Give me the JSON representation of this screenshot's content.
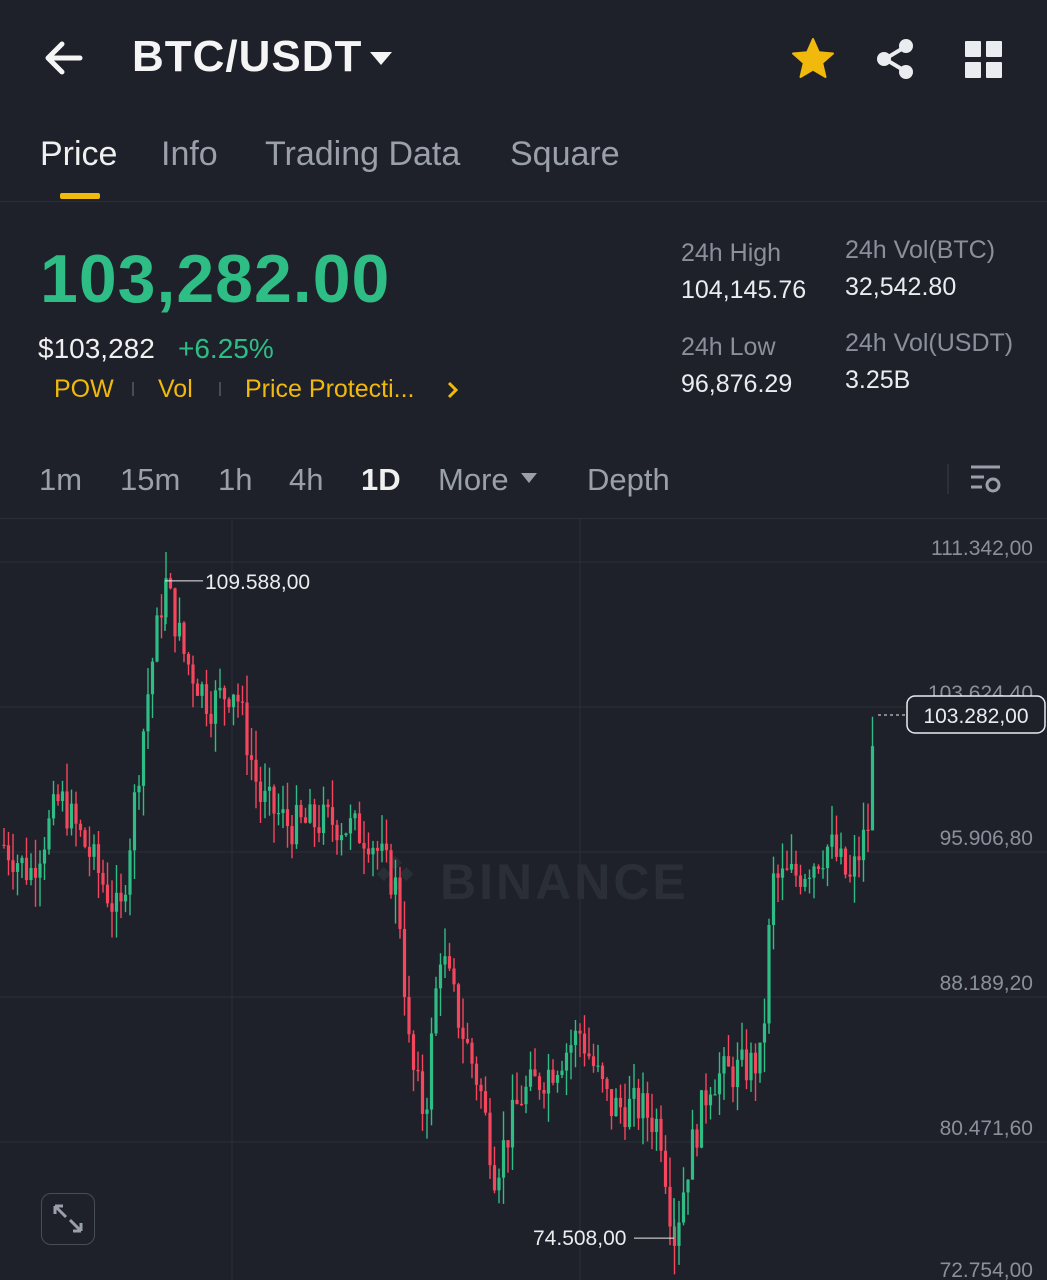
{
  "header": {
    "back_icon": "arrow-left-icon",
    "pair": "BTC/USDT",
    "favorite_icon": "star-icon",
    "share_icon": "share-icon",
    "menu_icon": "grid-icon"
  },
  "tabs": [
    {
      "label": "Price",
      "active": true
    },
    {
      "label": "Info",
      "active": false
    },
    {
      "label": "Trading Data",
      "active": false
    },
    {
      "label": "Square",
      "active": false
    }
  ],
  "ticker": {
    "price": "103,282.00",
    "usd": "$103,282",
    "change": "+6.25%",
    "tags": [
      "POW",
      "Vol",
      "Price Protecti..."
    ],
    "high_label": "24h High",
    "high_value": "104,145.76",
    "low_label": "24h Low",
    "low_value": "96,876.29",
    "vol_btc_label": "24h Vol(BTC)",
    "vol_btc_value": "32,542.80",
    "vol_usdt_label": "24h Vol(USDT)",
    "vol_usdt_value": "3.25B"
  },
  "intervals": {
    "items": [
      "1m",
      "15m",
      "1h",
      "4h",
      "1D"
    ],
    "active": "1D",
    "more": "More",
    "depth": "Depth"
  },
  "colors": {
    "up": "#2ebd85",
    "down": "#f6465d",
    "accent": "#f0b90b",
    "background": "#1e2129"
  },
  "chart_data": {
    "type": "candlestick",
    "y_ticks": [
      "111.342,00",
      "103.624,40",
      "95.906,80",
      "88.189,20",
      "80.471,60",
      "72.754,00"
    ],
    "y_range": [
      72754.0,
      111342.0
    ],
    "high_marker": "109.588,00",
    "low_marker": "74.508,00",
    "last_price_label": "103.282,00",
    "last_price": 103282.0,
    "watermark": "BINANCE"
  }
}
